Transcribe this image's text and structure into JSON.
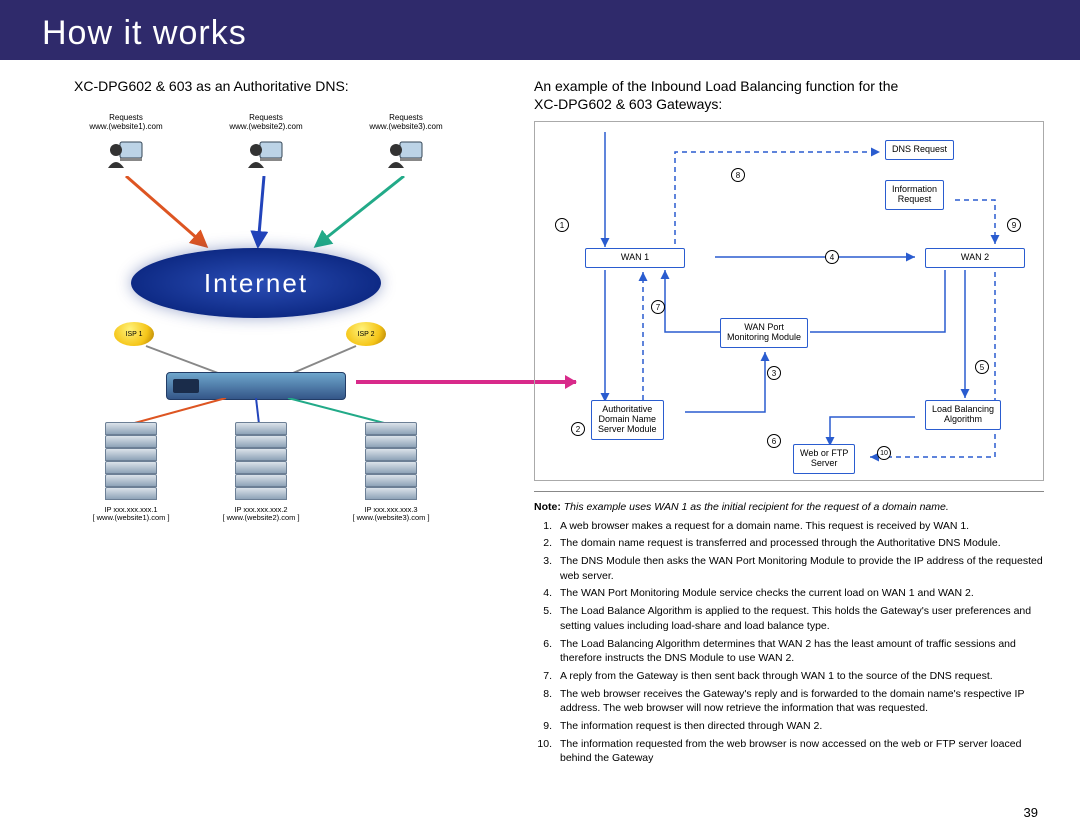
{
  "header": {
    "title": "How it works"
  },
  "left": {
    "title": "XC-DPG602 & 603 as an Authoritative DNS:",
    "requests": [
      {
        "t1": "Requests",
        "t2": "www.(website1).com"
      },
      {
        "t1": "Requests",
        "t2": "www.(website2).com"
      },
      {
        "t1": "Requests",
        "t2": "www.(website3).com"
      }
    ],
    "internet": "Internet",
    "isp1": "ISP 1",
    "isp2": "ISP 2",
    "servers": [
      {
        "ip": "IP xxx.xxx.xxx.1",
        "site": "[ www.(website1).com ]"
      },
      {
        "ip": "IP xxx.xxx.xxx.2",
        "site": "[ www.(website2).com ]"
      },
      {
        "ip": "IP xxx.xxx.xxx.3",
        "site": "[ www.(website3).com ]"
      }
    ]
  },
  "right": {
    "title_l1": "An example of the Inbound Load Balancing function for the",
    "title_l2": "XC-DPG602 & 603 Gateways:",
    "boxes": {
      "dns_req": "DNS Request",
      "info_req_l1": "Information",
      "info_req_l2": "Request",
      "wan1": "WAN 1",
      "wan2": "WAN 2",
      "wanport_l1": "WAN Port",
      "wanport_l2": "Monitoring Module",
      "auth_l1": "Authoritative",
      "auth_l2": "Domain Name",
      "auth_l3": "Server Module",
      "lb_l1": "Load Balancing",
      "lb_l2": "Algorithm",
      "web_l1": "Web or FTP",
      "web_l2": "Server"
    },
    "note": "Note:",
    "note_text": "This example uses WAN 1 as the initial recipient for the request of a domain name.",
    "steps": [
      "A web browser makes a request for a domain name. This request is received by WAN 1.",
      "The domain name request is transferred and processed through the Authoritative DNS Module.",
      "The DNS Module then asks the WAN Port Monitoring Module to provide the IP address of the requested web server.",
      "The WAN Port Monitoring Module service checks the current load on WAN 1 and WAN 2.",
      "The Load Balance Algorithm is applied to the request.  This holds the Gateway's user preferences and setting values including load-share and load balance type.",
      "The Load Balancing Algorithm determines that WAN 2 has the least amount of traffic sessions and therefore instructs the DNS Module to use WAN 2.",
      "A reply from the Gateway is then sent back through WAN 1 to the source of the DNS request.",
      "The web browser receives the Gateway's reply and is forwarded to the domain name's respective IP address.  The web browser will now retrieve the information that was requested.",
      "The information request is then directed through WAN 2.",
      "The information requested from the web browser is now accessed on the web or FTP server loaced behind the Gateway"
    ]
  },
  "page_number": "39"
}
